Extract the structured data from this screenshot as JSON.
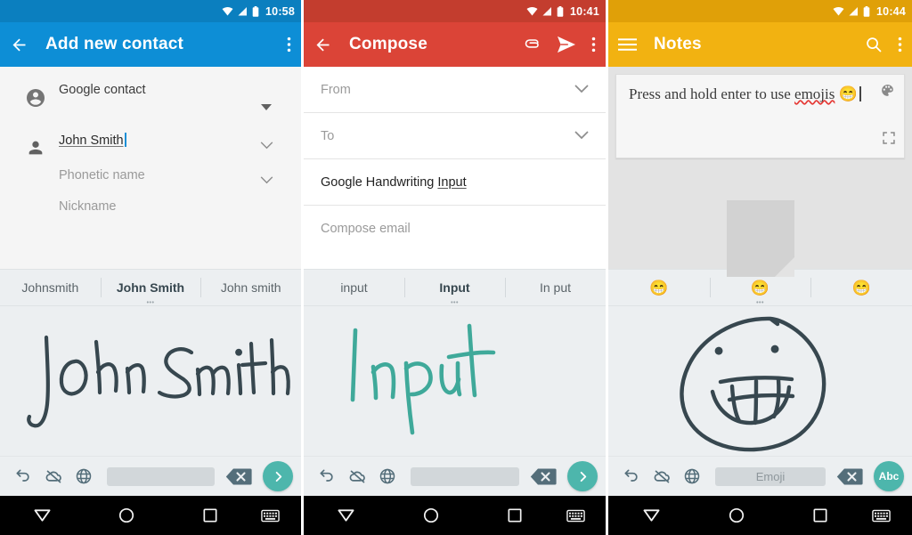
{
  "panels": [
    {
      "app": "contacts",
      "theme": {
        "statusbar": "#0b7fbf",
        "appbar": "#0d8ed6",
        "content": "#f5f5f5"
      },
      "status": {
        "time": "10:58",
        "wifi_icon": "wifi-icon",
        "signal_icon": "signal-icon",
        "battery_icon": "battery-icon"
      },
      "appbar": {
        "nav_icon": "back-arrow-icon",
        "title": "Add new contact",
        "overflow_icon": "more-vert-icon"
      },
      "form": {
        "account": {
          "icon": "account-circle-icon",
          "value": "Google contact",
          "dropdown_icon": "caret-down-icon"
        },
        "name": {
          "icon": "person-icon",
          "value": "John Smith",
          "expand_icon": "chevron-down-icon"
        },
        "phonetic": {
          "placeholder": "Phonetic name",
          "expand_icon": "chevron-down-icon"
        },
        "nickname": {
          "placeholder": "Nickname"
        }
      },
      "ime": {
        "suggestions": [
          {
            "label": "Johnsmith",
            "selected": false
          },
          {
            "label": "John Smith",
            "selected": true
          },
          {
            "label": "John smith",
            "selected": false
          }
        ],
        "ink_text": "John Smith",
        "ink_color": "#37474f",
        "keys": {
          "undo_icon": "undo-icon",
          "offline_icon": "cloud-off-icon",
          "language_icon": "globe-icon",
          "spacebar_label": "",
          "backspace_icon": "backspace-icon",
          "action_label": "›",
          "action_icon": "chevron-right-icon"
        }
      },
      "navbar": {
        "back_icon": "nav-back-triangle-icon",
        "home_icon": "nav-home-circle-icon",
        "recents_icon": "nav-recents-square-icon",
        "keyboard_icon": "nav-keyboard-icon"
      }
    },
    {
      "app": "gmail",
      "theme": {
        "statusbar": "#c33d2e",
        "appbar": "#db4437",
        "content": "#ffffff"
      },
      "status": {
        "time": "10:41",
        "wifi_icon": "wifi-icon",
        "signal_icon": "signal-icon",
        "battery_icon": "battery-icon"
      },
      "appbar": {
        "nav_icon": "back-arrow-icon",
        "title": "Compose",
        "attach_icon": "paperclip-icon",
        "send_icon": "send-icon",
        "overflow_icon": "more-vert-icon"
      },
      "fields": [
        {
          "label": "From",
          "filled": false,
          "expand_icon": "chevron-down-icon"
        },
        {
          "label": "To",
          "filled": false,
          "expand_icon": "chevron-down-icon"
        },
        {
          "label": "Google Handwriting ",
          "underlined_tail": "Input",
          "filled": true
        },
        {
          "label": "Compose email",
          "filled": false
        }
      ],
      "ime": {
        "suggestions": [
          {
            "label": "input",
            "selected": false
          },
          {
            "label": "Input",
            "selected": true
          },
          {
            "label": "In put",
            "selected": false
          }
        ],
        "ink_text": "Input",
        "ink_color": "#3fa99a",
        "keys": {
          "undo_icon": "undo-icon",
          "offline_icon": "cloud-off-icon",
          "language_icon": "globe-icon",
          "spacebar_label": "",
          "backspace_icon": "backspace-icon",
          "action_label": "›",
          "action_icon": "chevron-right-icon"
        }
      },
      "navbar": {
        "back_icon": "nav-back-triangle-icon",
        "home_icon": "nav-home-circle-icon",
        "recents_icon": "nav-recents-square-icon",
        "keyboard_icon": "nav-keyboard-icon"
      }
    },
    {
      "app": "notes",
      "theme": {
        "statusbar": "#e0a008",
        "appbar": "#f2b211",
        "content": "#e3e3e3"
      },
      "status": {
        "time": "10:44",
        "wifi_icon": "wifi-icon",
        "signal_icon": "signal-icon",
        "battery_icon": "battery-icon"
      },
      "appbar": {
        "nav_icon": "hamburger-menu-icon",
        "title": "Notes",
        "search_icon": "search-icon",
        "overflow_icon": "more-vert-icon"
      },
      "note": {
        "text_prefix": "Press and hold enter to use ",
        "misspelled_word": "emojis",
        "emoji": "😁",
        "palette_icon": "palette-icon",
        "expand_icon": "fullscreen-icon"
      },
      "ime": {
        "suggestions": [
          {
            "label": "😁",
            "selected": false,
            "is_emoji": true
          },
          {
            "label": "😁",
            "selected": true,
            "is_emoji": true
          },
          {
            "label": "😁",
            "selected": false,
            "is_emoji": true
          }
        ],
        "ink_text": "smiley-face-drawing",
        "ink_color": "#37474f",
        "keys": {
          "undo_icon": "undo-icon",
          "offline_icon": "cloud-off-icon",
          "language_icon": "globe-icon",
          "spacebar_label": "Emoji",
          "backspace_icon": "backspace-icon",
          "action_label": "Abc",
          "action_icon": "abc-mode-icon"
        }
      },
      "navbar": {
        "back_icon": "nav-back-triangle-icon",
        "home_icon": "nav-home-circle-icon",
        "recents_icon": "nav-recents-square-icon",
        "keyboard_icon": "nav-keyboard-icon"
      }
    }
  ]
}
